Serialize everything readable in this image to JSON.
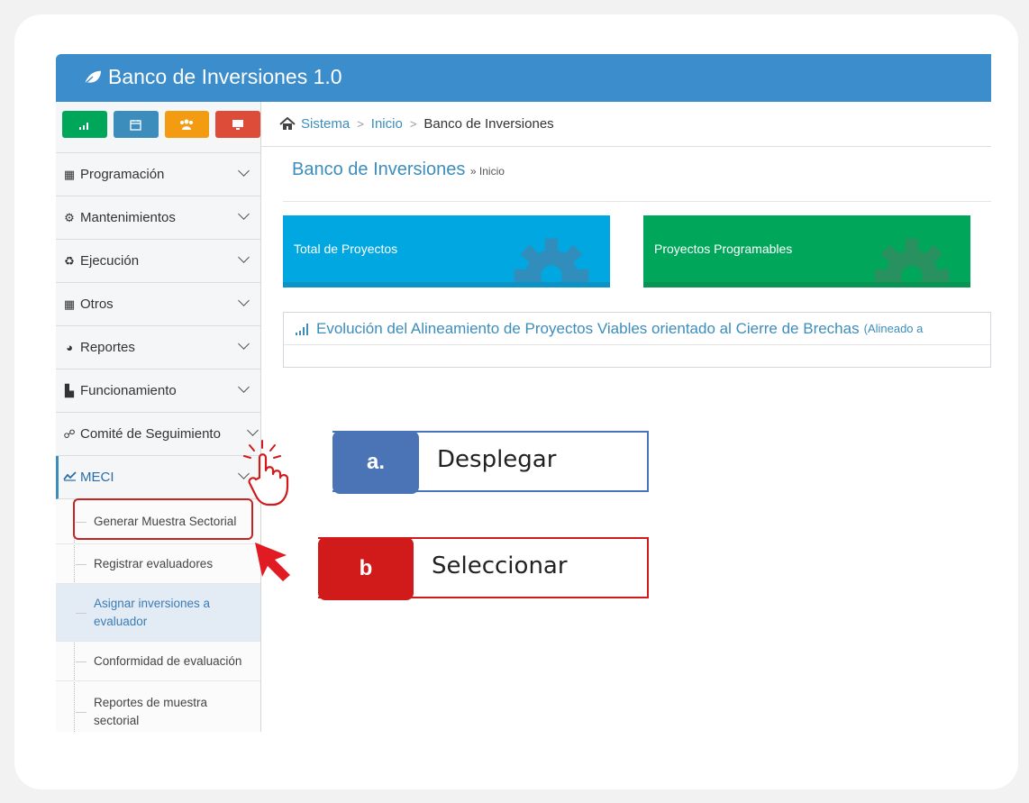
{
  "app": {
    "title": "Banco de Inversiones 1.0"
  },
  "breadcrumb": {
    "items": [
      "Sistema",
      "Inicio"
    ],
    "current": "Banco de Inversiones"
  },
  "page_header": {
    "title": "Banco de Inversiones",
    "subtitle": "» Inicio"
  },
  "shortcuts": [
    {
      "icon": "bar-chart-icon",
      "color": "#00a65a"
    },
    {
      "icon": "calendar-icon",
      "color": "#3c8dbc"
    },
    {
      "icon": "users-icon",
      "color": "#f39c12"
    },
    {
      "icon": "monitor-icon",
      "color": "#dd4b39"
    }
  ],
  "sidebar": {
    "items": [
      {
        "label": "Programación",
        "icon": "calendar-icon"
      },
      {
        "label": "Mantenimientos",
        "icon": "cogs-icon"
      },
      {
        "label": "Ejecución",
        "icon": "recycle-icon"
      },
      {
        "label": "Otros",
        "icon": "grid-icon"
      },
      {
        "label": "Reportes",
        "icon": "pie-chart-icon"
      },
      {
        "label": "Funcionamiento",
        "icon": "industry-icon"
      },
      {
        "label": "Comité de Seguimiento",
        "icon": "handshake-icon"
      },
      {
        "label": "MECI",
        "icon": "line-chart-icon"
      }
    ],
    "submenu": [
      {
        "label": "Generar Muestra Sectorial"
      },
      {
        "label": "Registrar evaluadores"
      },
      {
        "label": "Asignar inversiones a evaluador"
      },
      {
        "label": "Conformidad de evaluación"
      },
      {
        "label": "Reportes de muestra sectorial"
      }
    ]
  },
  "boxes": [
    {
      "label": "Total de Proyectos",
      "color": "#00a7e0"
    },
    {
      "label": "Proyectos Programables",
      "color": "#00a65a"
    }
  ],
  "chart_panel": {
    "title": "Evolución del Alineamiento de Proyectos Viables orientado al Cierre de Brechas",
    "subtitle": "(Alineado a"
  },
  "callouts": {
    "a": {
      "tag": "a.",
      "text": "Desplegar",
      "color": "#4a74b5"
    },
    "b": {
      "tag": "b",
      "text": "Seleccionar",
      "color": "#d11a1a"
    }
  }
}
